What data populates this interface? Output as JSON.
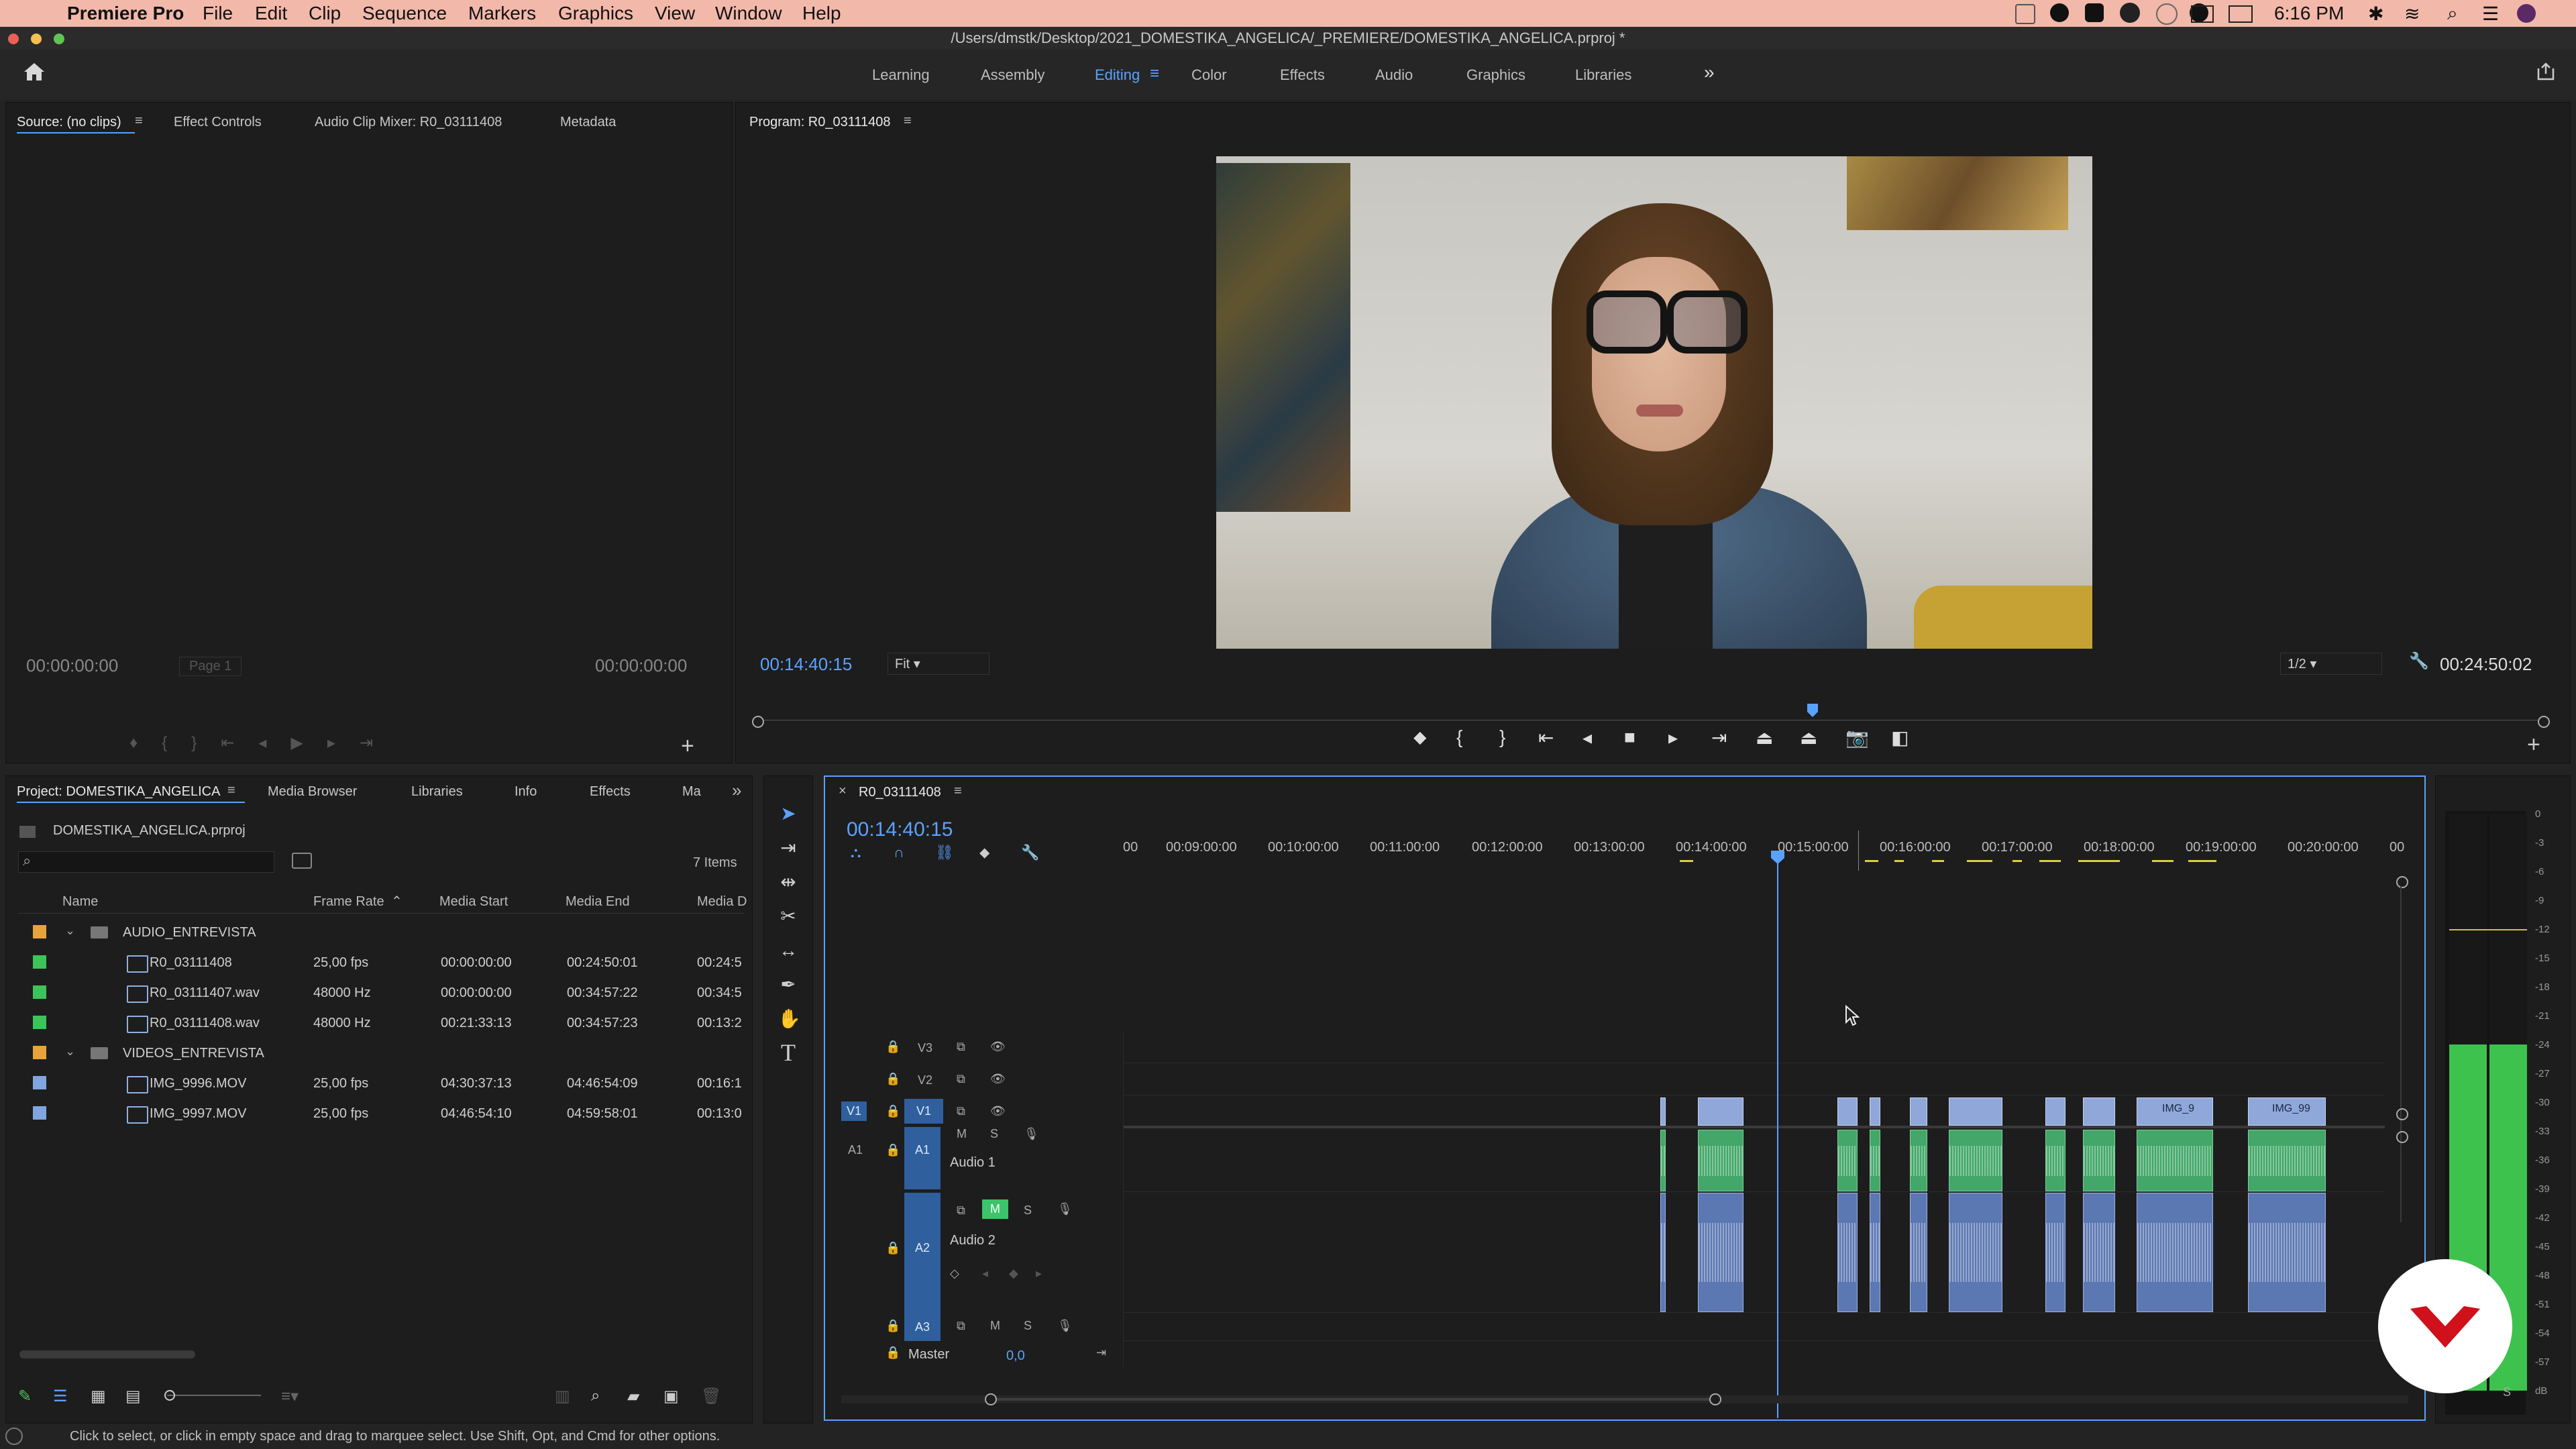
{
  "menubar": {
    "app": "Premiere Pro",
    "items": [
      "File",
      "Edit",
      "Clip",
      "Sequence",
      "Markers",
      "Graphics",
      "View",
      "Window",
      "Help"
    ],
    "clock": "6:16 PM"
  },
  "titlebar": {
    "path": "/Users/dmstk/Desktop/2021_DOMESTIKA_ANGELICA/_PREMIERE/DOMESTIKA_ANGELICA.prproj *"
  },
  "workspaces": {
    "tabs": [
      "Learning",
      "Assembly",
      "Editing",
      "Color",
      "Effects",
      "Audio",
      "Graphics",
      "Libraries"
    ],
    "active": "Editing"
  },
  "source_panel": {
    "tabs": [
      "Source: (no clips)",
      "Effect Controls",
      "Audio Clip Mixer: R0_03111408",
      "Metadata"
    ],
    "timecode_left": "00:00:00:00",
    "page": "Page 1",
    "timecode_right": "00:00:00:00"
  },
  "program_panel": {
    "title": "Program: R0_03111408",
    "timecode": "00:14:40:15",
    "fit": "Fit",
    "resolution": "1/2",
    "duration": "00:24:50:02",
    "playhead_fraction": 0.59
  },
  "project_panel": {
    "tabs": [
      "Project: DOMESTIKA_ANGELICA",
      "Media Browser",
      "Libraries",
      "Info",
      "Effects",
      "Ma"
    ],
    "project_file": "DOMESTIKA_ANGELICA.prproj",
    "item_count": "7 Items",
    "columns": [
      "Name",
      "Frame Rate",
      "Media Start",
      "Media End",
      "Media D"
    ],
    "rows": [
      {
        "type": "folder",
        "name": "AUDIO_ENTREVISTA",
        "fps": "",
        "start": "",
        "end": "",
        "dur": "",
        "color": "#e8a33c",
        "indent": 0
      },
      {
        "type": "sequence",
        "name": "R0_03111408",
        "fps": "25,00 fps",
        "start": "00:00:00:00",
        "end": "00:24:50:01",
        "dur": "00:24:5",
        "color": "#3ec35a",
        "indent": 1
      },
      {
        "type": "audio",
        "name": "R0_03111407.wav",
        "fps": "48000 Hz",
        "start": "00:00:00:00",
        "end": "00:34:57:22",
        "dur": "00:34:5",
        "color": "#3ec35a",
        "indent": 1
      },
      {
        "type": "audio",
        "name": "R0_03111408.wav",
        "fps": "48000 Hz",
        "start": "00:21:33:13",
        "end": "00:34:57:23",
        "dur": "00:13:2",
        "color": "#3ec35a",
        "indent": 1
      },
      {
        "type": "folder",
        "name": "VIDEOS_ENTREVISTA",
        "fps": "",
        "start": "",
        "end": "",
        "dur": "",
        "color": "#e8a33c",
        "indent": 0
      },
      {
        "type": "video",
        "name": "IMG_9996.MOV",
        "fps": "25,00 fps",
        "start": "04:30:37:13",
        "end": "04:46:54:09",
        "dur": "00:16:1",
        "color": "#7fa6e0",
        "indent": 1
      },
      {
        "type": "video",
        "name": "IMG_9997.MOV",
        "fps": "25,00 fps",
        "start": "04:46:54:10",
        "end": "04:59:58:01",
        "dur": "00:13:0",
        "color": "#7fa6e0",
        "indent": 1
      }
    ]
  },
  "timeline": {
    "sequence": "R0_03111408",
    "timecode": "00:14:40:15",
    "ruler": [
      "00",
      "00:09:00:00",
      "00:10:00:00",
      "00:11:00:00",
      "00:12:00:00",
      "00:13:00:00",
      "00:14:00:00",
      "00:15:00:00",
      "00:16:00:00",
      "00:17:00:00",
      "00:18:00:00",
      "00:19:00:00",
      "00:20:00:00",
      "00"
    ],
    "tracks": {
      "video": [
        "V3",
        "V2",
        "V1"
      ],
      "audio": [
        "A1",
        "A2",
        "A3"
      ],
      "audio_names": [
        "Audio 1",
        "Audio 2"
      ],
      "master": "Master",
      "master_value": "0,0"
    },
    "clip_labels": [
      "IMG_9",
      "IMG_99"
    ],
    "track_buttons": {
      "mute": "M",
      "solo": "S",
      "rec": "R"
    }
  },
  "meter": {
    "scale": [
      "0",
      "-3",
      "-6",
      "-9",
      "-12",
      "-15",
      "-18",
      "-21",
      "-24",
      "-27",
      "-30",
      "-33",
      "-36",
      "-39",
      "-42",
      "-45",
      "-48",
      "-51",
      "-54",
      "-57",
      "dB"
    ],
    "level_db": -24,
    "solo": "S"
  },
  "status": "Click to select, or click in empty space and drag to marquee select. Use Shift, Opt, and Cmd for other options."
}
